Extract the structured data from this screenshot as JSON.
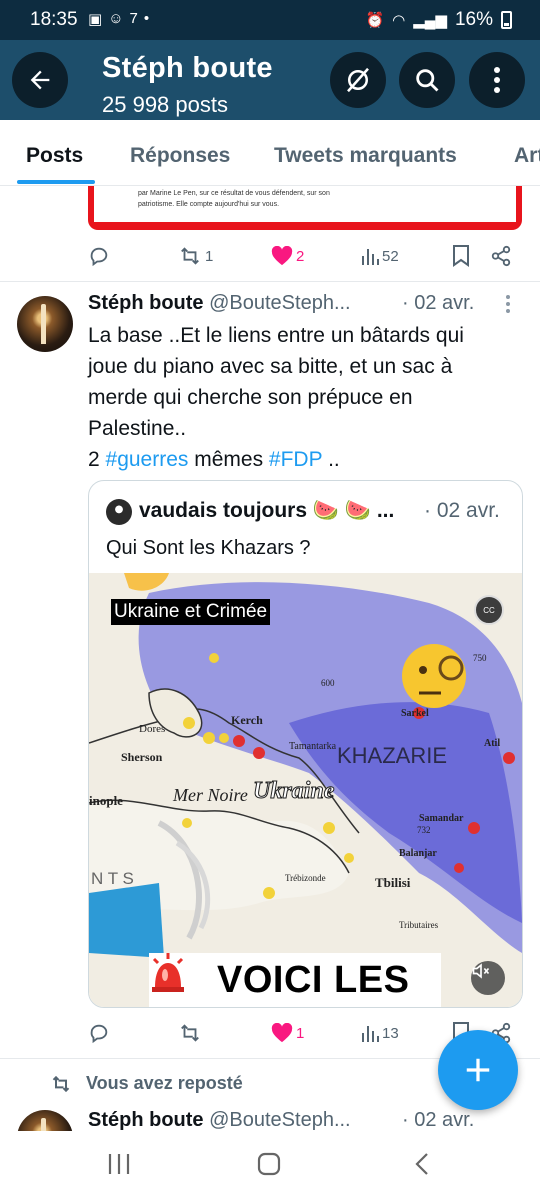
{
  "status_bar": {
    "time": "18:35",
    "battery": "16%"
  },
  "header": {
    "title": "Stéph boute",
    "subtitle": "25 998 posts"
  },
  "tabs": [
    {
      "label": "Posts",
      "active": true
    },
    {
      "label": "Réponses"
    },
    {
      "label": "Tweets marquants"
    },
    {
      "label": "Art"
    }
  ],
  "prev_tweet": {
    "card_text_1": "par Marine Le Pen, sur ce résultat de vous défendent, sur son",
    "card_text_2": "patriotisme. Elle compte aujourd'hui sur vous.",
    "stats": {
      "replies": "",
      "reposts": "1",
      "likes": "2",
      "views": "52"
    }
  },
  "tweet": {
    "name": "Stéph boute",
    "handle": "@BouteSteph...",
    "date": "· 02 avr.",
    "text_lines": [
      "La base ..Et le liens entre un bâtards qui",
      "joue du piano avec sa bitte, et un sac à",
      "merde qui cherche son prépuce en",
      "Palestine.."
    ],
    "last_line_prefix": "2 ",
    "tag1": "#guerres",
    "mid": " mêmes ",
    "tag2": "#FDP",
    "suffix": " ..",
    "quote": {
      "name": "vaudais toujours 🍉 🍉 ...",
      "date": "· 02 avr.",
      "text": "Qui Sont les Khazars ?",
      "video": {
        "caption": "Ukraine et Crimée",
        "cc": "CC",
        "labels": {
          "khazarie": "KHAZARIE",
          "ukraine": "Ukraine",
          "mer_noire": "Mer Noire",
          "kerch": "Kerch",
          "dores": "Dores",
          "sherson": "Sherson",
          "inople": "inople",
          "tmutarakan": "Tamantarka",
          "sarkel": "Sarkel",
          "atil": "Atil",
          "samandar": "Samandar",
          "n732": "732",
          "balanjar": "Balanjar",
          "tbilisi": "Tbilisi",
          "trebizonde": "Trébizonde",
          "tributaires": "Tributaires",
          "n600": "600",
          "n750": "750",
          "ntis": "N T  S"
        },
        "banner": "VOICI LES"
      }
    },
    "stats": {
      "replies": "",
      "reposts": "",
      "likes": "1",
      "views": "13"
    }
  },
  "repost_notice": "Vous avez reposté",
  "next_tweet": {
    "name": "Stéph boute",
    "handle": "@BouteSteph...",
    "date": "· 02 avr."
  },
  "colors": {
    "accent": "#1d9bf0",
    "header_bg": "#1d4e6b",
    "like": "#f91880"
  }
}
